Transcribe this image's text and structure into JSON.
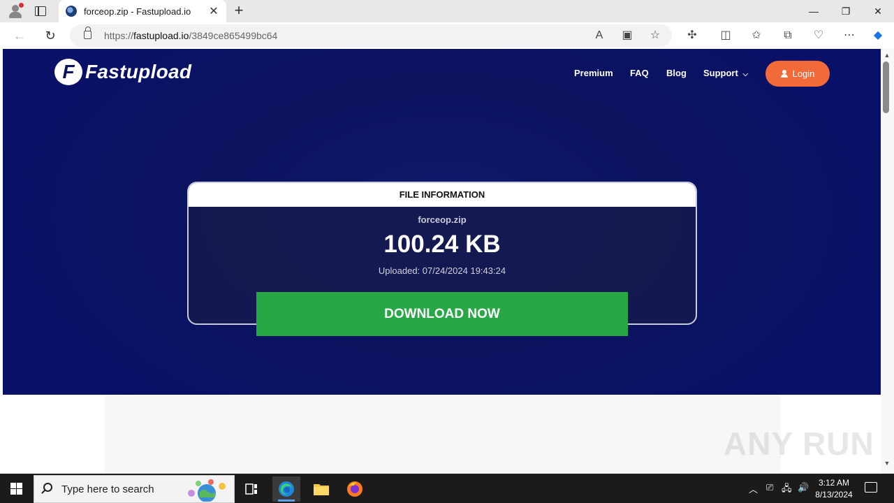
{
  "browser": {
    "tab_title": "forceop.zip - Fastupload.io",
    "url_prefix": "https://",
    "url_host": "fastupload.io",
    "url_path": "/3849ce865499bc64",
    "new_tab_glyph": "+",
    "tab_close_glyph": "✕",
    "window_controls": {
      "minimize": "—",
      "maximize": "❐",
      "close": "✕"
    }
  },
  "site": {
    "logo_text": "Fastupload",
    "logo_mark": "F",
    "nav": [
      {
        "label": "Premium"
      },
      {
        "label": "FAQ"
      },
      {
        "label": "Blog"
      },
      {
        "label": "Support"
      }
    ],
    "support_chevron": "⌵",
    "login_label": "Login"
  },
  "file_card": {
    "heading": "FILE INFORMATION",
    "file_name": "forceop.zip",
    "file_size": "100.24 KB",
    "uploaded": "Uploaded: 07/24/2024 19:43:24",
    "download_label": "DOWNLOAD NOW"
  },
  "watermark": "ANY RUN",
  "taskbar": {
    "search_placeholder": "Type here to search",
    "time": "3:12 AM",
    "date": "8/13/2024"
  },
  "colors": {
    "hero_bg": "#0c1460",
    "login_btn": "#f26a38",
    "download_btn": "#28a745"
  }
}
